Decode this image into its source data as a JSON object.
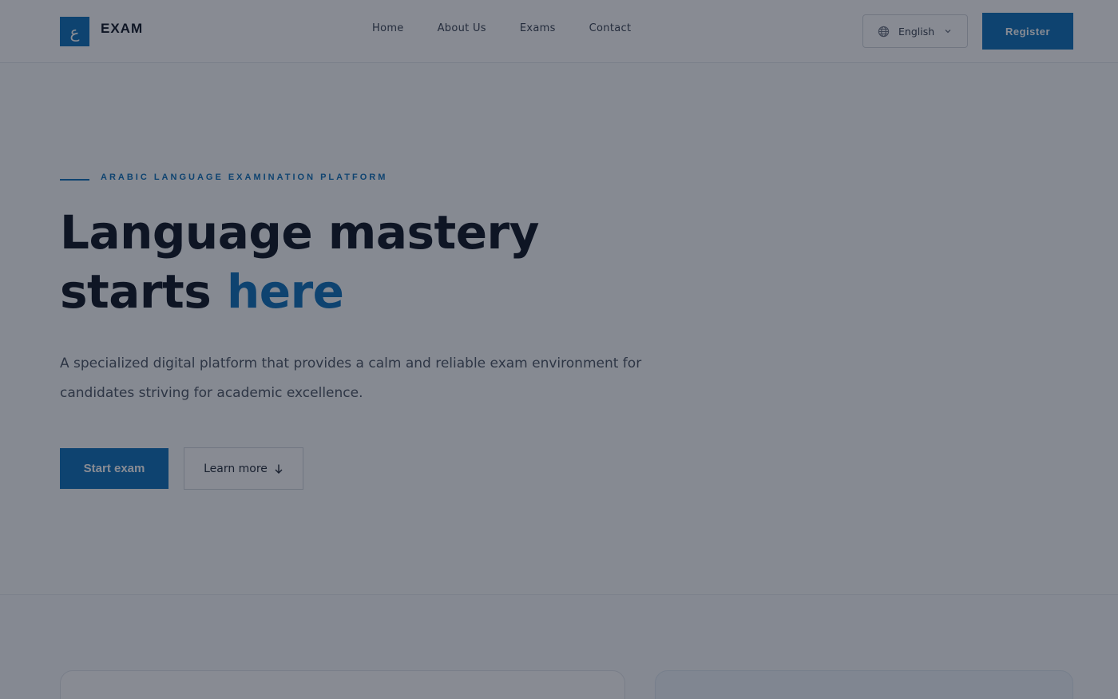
{
  "header": {
    "logo_glyph": "ع",
    "logo_text": "EXAM",
    "nav": [
      "Home",
      "About Us",
      "Exams",
      "Contact"
    ],
    "language": "English",
    "register_label": "Register",
    "accent_color": "#0a6fb8"
  },
  "hero": {
    "eyebrow": "ARABIC LANGUAGE EXAMINATION PLATFORM",
    "title_line1": "Language mastery",
    "title_line2_plain": "starts ",
    "title_line2_accent": "here",
    "description": "A specialized digital platform that provides a calm and reliable exam environment for candidates striving for academic excellence.",
    "start_label": "Start exam",
    "learn_label": "Learn more"
  },
  "icons": {
    "language": "globe-icon",
    "dropdown": "chevron-down-icon",
    "learn_more": "arrow-down-icon"
  },
  "overlay": {
    "color": "#111827",
    "opacity": 0.5
  }
}
